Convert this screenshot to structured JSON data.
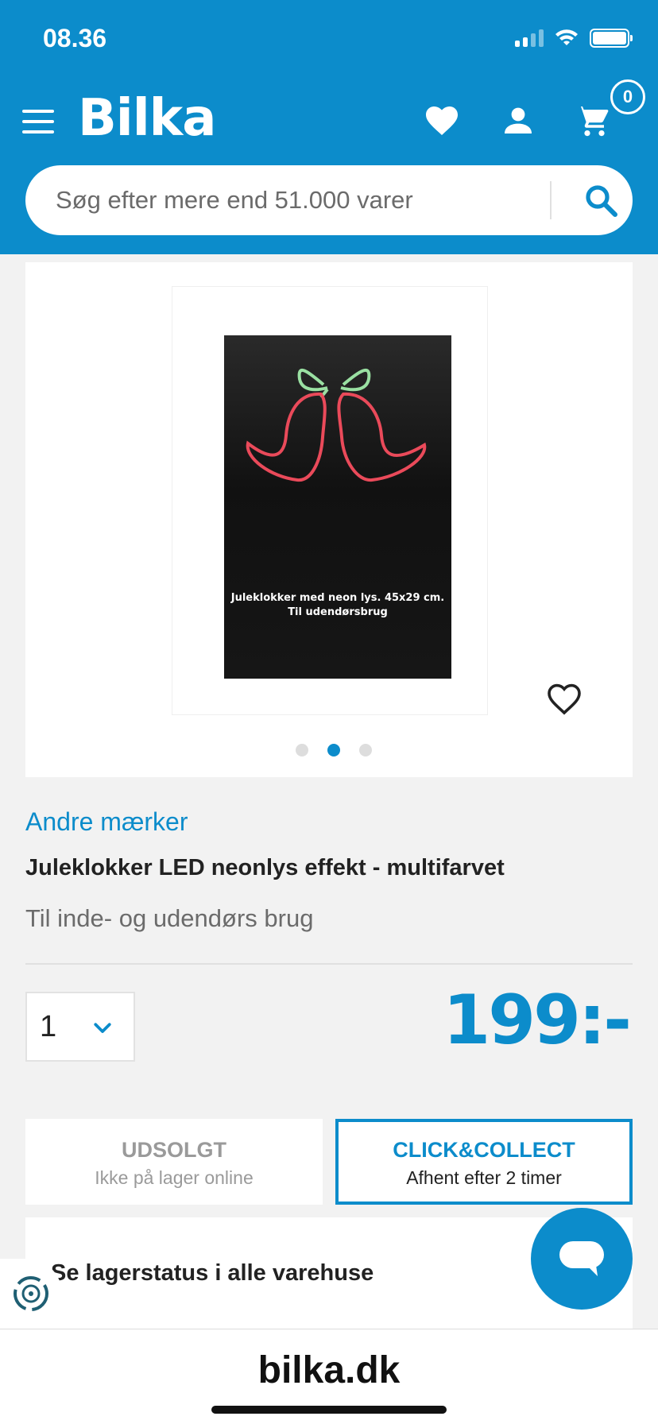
{
  "status_bar": {
    "time": "08.36"
  },
  "header": {
    "logo": "Bilka",
    "cart_count": "0",
    "search_placeholder": "Søg efter mere end 51.000 varer",
    "brand_color": "#0c8ccb"
  },
  "product": {
    "box_caption_line1": "Juleklokker med neon lys. 45x29 cm.",
    "box_caption_line2": "Til udendørsbrug",
    "image_count": 3,
    "active_image": 2,
    "brand": "Andre mærker",
    "title": "Juleklokker LED neonlys effekt - multifarvet",
    "subtitle": "Til inde- og udendørs brug",
    "quantity": "1",
    "price": "199:-"
  },
  "actions": {
    "sold_out_title": "UDSOLGT",
    "sold_out_sub": "Ikke på lager online",
    "click_collect_title": "CLICK&COLLECT",
    "click_collect_sub": "Afhent efter 2 timer"
  },
  "stock": {
    "link": "Se lagerstatus i alle varehuse"
  },
  "browser": {
    "domain": "bilka.dk"
  },
  "icons": [
    "menu-icon",
    "heart-icon",
    "user-icon",
    "cart-icon",
    "search-icon",
    "chevron-down-icon",
    "chat-icon",
    "accessibility-icon"
  ]
}
